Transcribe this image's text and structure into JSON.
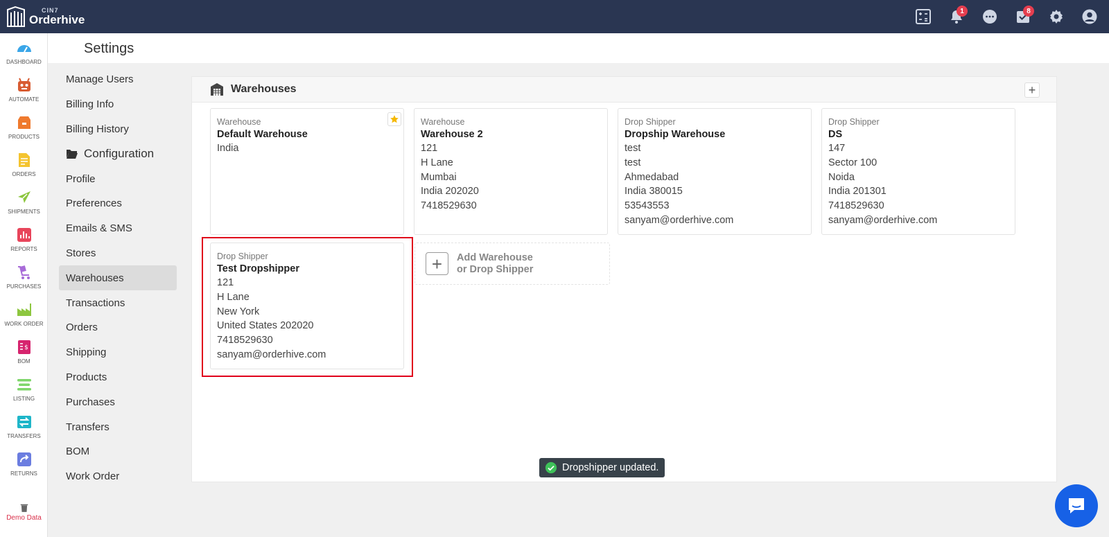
{
  "app": {
    "brand_sup": "CIN7",
    "brand_name": "Orderhive"
  },
  "topbar": {
    "notifications_badge": "1",
    "tasks_badge": "8"
  },
  "leftnav": {
    "items": [
      {
        "label": "DASHBOARD",
        "icon": "dashboard-icon"
      },
      {
        "label": "AUTOMATE",
        "icon": "robot-icon"
      },
      {
        "label": "PRODUCTS",
        "icon": "box-icon"
      },
      {
        "label": "ORDERS",
        "icon": "document-icon"
      },
      {
        "label": "SHIPMENTS",
        "icon": "plane-icon"
      },
      {
        "label": "REPORTS",
        "icon": "bar-chart-icon"
      },
      {
        "label": "PURCHASES",
        "icon": "cart-icon"
      },
      {
        "label": "WORK ORDER",
        "icon": "factory-icon"
      },
      {
        "label": "BOM",
        "icon": "bom-icon"
      },
      {
        "label": "LISTING",
        "icon": "listing-icon"
      },
      {
        "label": "TRANSFERS",
        "icon": "transfer-icon"
      },
      {
        "label": "RETURNS",
        "icon": "return-icon"
      }
    ],
    "demo_data": "Demo Data"
  },
  "header": {
    "title": "Settings"
  },
  "menu": {
    "items": [
      "Manage Users",
      "Billing Info",
      "Billing History",
      "Configuration",
      "Profile",
      "Preferences",
      "Emails & SMS",
      "Stores",
      "Warehouses",
      "Transactions",
      "Orders",
      "Shipping",
      "Products",
      "Purchases",
      "Transfers",
      "BOM",
      "Work Order"
    ],
    "active": "Warehouses"
  },
  "panel": {
    "title": "Warehouses",
    "add_button": "+",
    "cards": [
      {
        "type": "Warehouse",
        "name": "Default Warehouse",
        "lines": [
          "India"
        ],
        "default": true
      },
      {
        "type": "Warehouse",
        "name": "Warehouse 2",
        "lines": [
          "121",
          "H Lane",
          "Mumbai",
          "India 202020",
          "7418529630"
        ]
      },
      {
        "type": "Drop Shipper",
        "name": "Dropship Warehouse",
        "lines": [
          "test",
          "test",
          "Ahmedabad",
          "India 380015",
          "53543553",
          "sanyam@orderhive.com"
        ]
      },
      {
        "type": "Drop Shipper",
        "name": "DS",
        "lines": [
          "147",
          "Sector 100",
          "Noida",
          "India 201301",
          "7418529630",
          "sanyam@orderhive.com"
        ]
      },
      {
        "type": "Drop Shipper",
        "name": "Test Dropshipper",
        "lines": [
          "121",
          "H Lane",
          "New York",
          "United States 202020",
          "7418529630",
          "sanyam@orderhive.com"
        ]
      }
    ],
    "add_card": {
      "line1": "Add Warehouse",
      "line2": "or Drop Shipper"
    }
  },
  "toast": {
    "message": "Dropshipper updated."
  },
  "colors": {
    "topbar": "#2a3652",
    "highlight": "#e0001b",
    "toast_bg": "#38424a",
    "chat": "#1761e6",
    "success": "#3ec159"
  }
}
